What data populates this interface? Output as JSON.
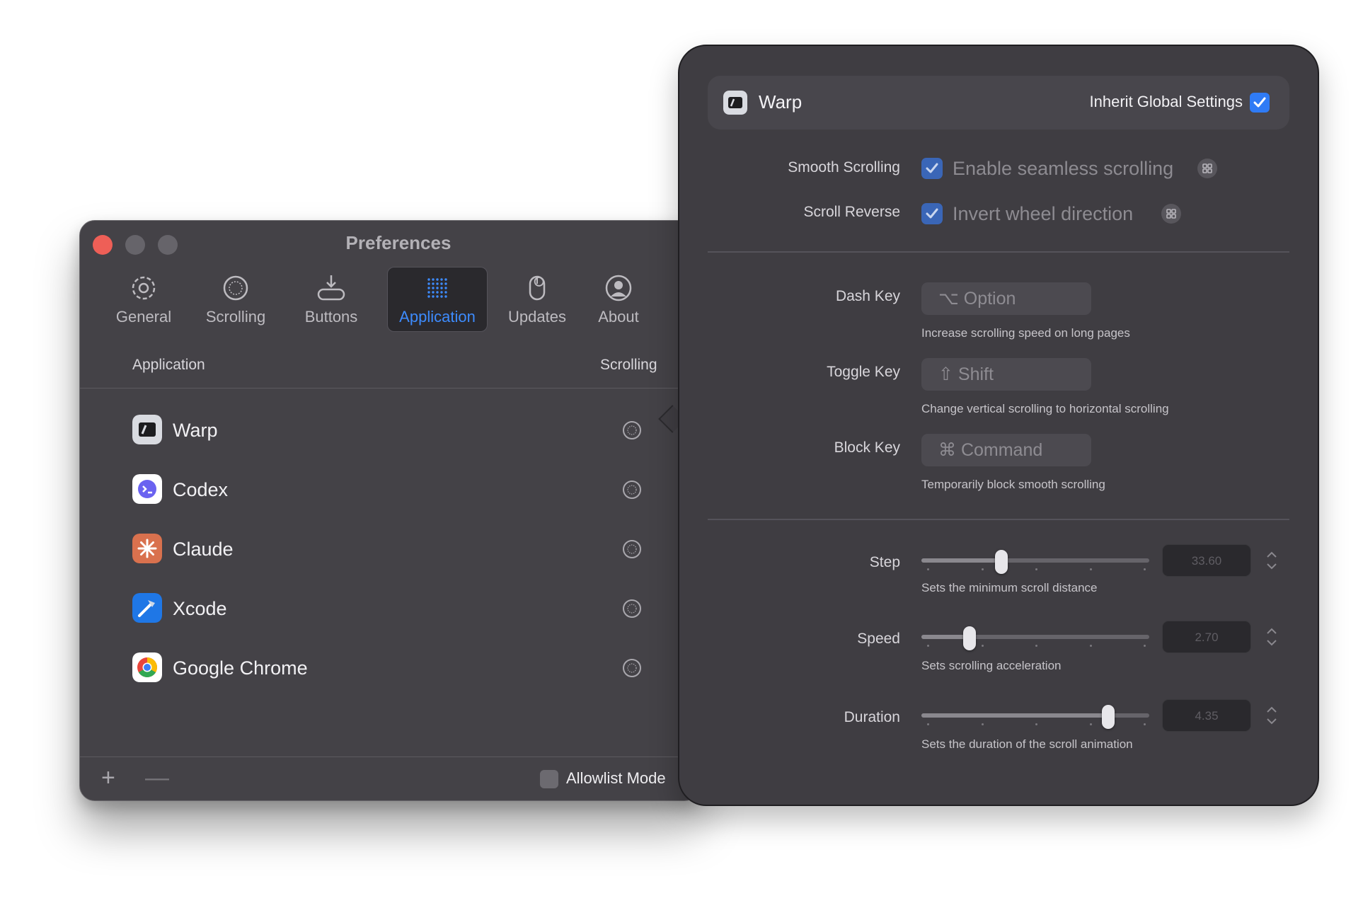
{
  "window": {
    "title": "Preferences",
    "tabs": [
      {
        "label": "General",
        "icon": "gear-icon"
      },
      {
        "label": "Scrolling",
        "icon": "scroll-circle-icon"
      },
      {
        "label": "Buttons",
        "icon": "mouse-buttons-icon"
      },
      {
        "label": "Application",
        "icon": "grid-dots-icon",
        "active": true
      },
      {
        "label": "Updates",
        "icon": "mouse-refresh-icon"
      },
      {
        "label": "About",
        "icon": "person-circle-icon"
      }
    ],
    "columns": {
      "application": "Application",
      "scrolling": "Scrolling"
    },
    "apps": [
      {
        "name": "Warp",
        "icon": "warp-app-icon"
      },
      {
        "name": "Codex",
        "icon": "codex-app-icon"
      },
      {
        "name": "Claude",
        "icon": "claude-app-icon"
      },
      {
        "name": "Xcode",
        "icon": "xcode-app-icon"
      },
      {
        "name": "Google Chrome",
        "icon": "chrome-app-icon"
      }
    ],
    "add_label": "+",
    "remove_label": "—",
    "allowlist_label": "Allowlist Mode",
    "accent": "#3d8bfd"
  },
  "popover": {
    "app_name": "Warp",
    "inherit_label": "Inherit Global Settings",
    "inherit_checked": true,
    "smooth_scrolling": {
      "label": "Smooth Scrolling",
      "option": "Enable seamless scrolling",
      "checked": true
    },
    "scroll_reverse": {
      "label": "Scroll Reverse",
      "option": "Invert wheel direction",
      "checked": true
    },
    "dash_key": {
      "label": "Dash Key",
      "value": "⌥ Option",
      "hint": "Increase scrolling speed on long pages"
    },
    "toggle_key": {
      "label": "Toggle Key",
      "value": "⇧ Shift",
      "hint": "Change vertical scrolling to horizontal scrolling"
    },
    "block_key": {
      "label": "Block Key",
      "value": "⌘ Command",
      "hint": "Temporarily block smooth scrolling"
    },
    "step": {
      "label": "Step",
      "value": "33.60",
      "level": 0.35,
      "hint": "Sets the minimum scroll distance"
    },
    "speed": {
      "label": "Speed",
      "value": "2.70",
      "level": 0.21,
      "hint": "Sets scrolling acceleration"
    },
    "duration": {
      "label": "Duration",
      "value": "4.35",
      "level": 0.82,
      "hint": "Sets the duration of the scroll animation"
    }
  }
}
